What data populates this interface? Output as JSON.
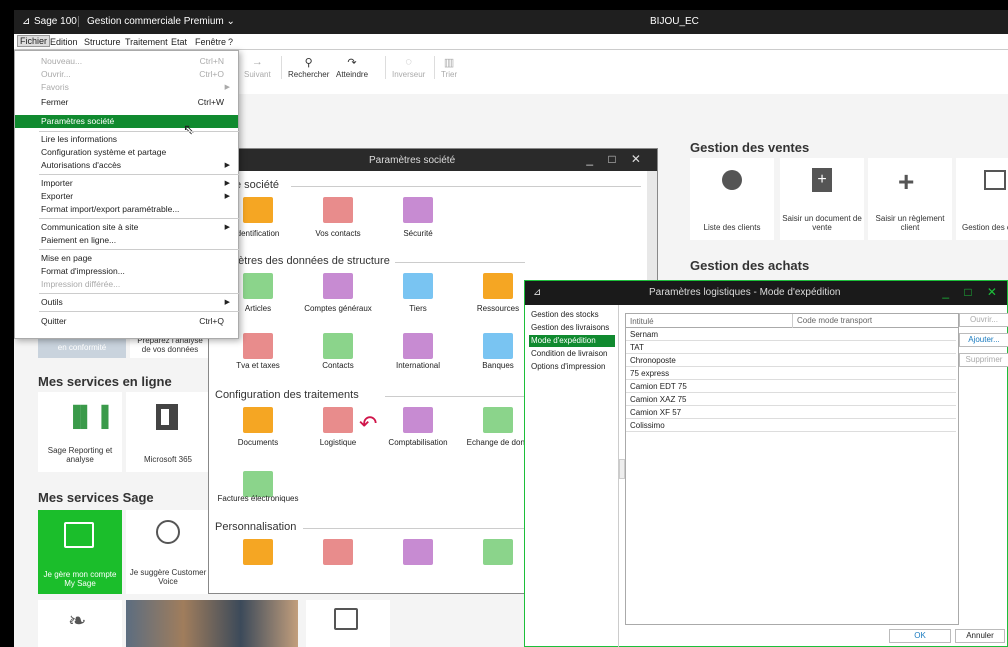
{
  "titlebar": {
    "logo": "⊿",
    "app": "Sage 100",
    "product": "Gestion commerciale Premium ⌄",
    "company": "BIJOU_EC"
  },
  "menubar": [
    "Fichier",
    "Edition",
    "Structure",
    "Traitement",
    "Etat",
    "Fenêtre",
    "?"
  ],
  "toolbar": [
    {
      "label": "nt",
      "icon": ""
    },
    {
      "label": "Suivant",
      "icon": "→",
      "dim": true
    },
    {
      "label": "Rechercher",
      "icon": "🔍"
    },
    {
      "label": "Atteindre",
      "icon": "↷"
    },
    {
      "label": "Inverseur",
      "icon": "◌",
      "dim": true
    },
    {
      "label": "Trier",
      "icon": "▥",
      "dim": true
    }
  ],
  "dropdown": [
    {
      "label": "Nouveau...",
      "shortcut": "Ctrl+N",
      "disabled": true
    },
    {
      "label": "Ouvrir...",
      "shortcut": "Ctrl+O",
      "disabled": true
    },
    {
      "label": "Favoris",
      "arrow": true,
      "disabled": true
    },
    {
      "label": "Fermer",
      "shortcut": "Ctrl+W"
    },
    {
      "label": "Paramètres société",
      "selected": true
    },
    {
      "label": "Lire les informations"
    },
    {
      "label": "Configuration système et partage"
    },
    {
      "label": "Autorisations d'accès",
      "arrow": true
    },
    {
      "label": "Importer",
      "arrow": true
    },
    {
      "label": "Exporter",
      "arrow": true
    },
    {
      "label": "Format import/export paramétrable..."
    },
    {
      "label": "Communication site à site",
      "arrow": true
    },
    {
      "label": "Paiement en ligne..."
    },
    {
      "label": "Mise en page"
    },
    {
      "label": "Format d'impression..."
    },
    {
      "label": "Impression différée...",
      "disabled": true
    },
    {
      "label": "Outils",
      "arrow": true
    },
    {
      "label": "Quitter",
      "shortcut": "Ctrl+Q"
    }
  ],
  "left": {
    "partial_cards": [
      "en conformité",
      "Préparez l'analyse de vos données"
    ],
    "services_online": "Mes services en ligne",
    "reporting": "Sage Reporting et analyse",
    "m365": "Microsoft 365",
    "services_sage": "Mes services Sage",
    "mysage": "Je gère mon compte My Sage",
    "voice": "Je suggère Customer Voice"
  },
  "ventes": {
    "title": "Gestion des ventes",
    "cards": [
      "Liste des clients",
      "Saisir un document de vente",
      "Saisir un règlement client",
      "Gestion des comptes cl"
    ]
  },
  "achats": {
    "title": "Gestion des achats"
  },
  "params": {
    "title": "Paramètres société",
    "sec1": "e société",
    "sec1_items": [
      "dentification",
      "Vos contacts",
      "Sécurité"
    ],
    "sec2": "mètres des données de structure",
    "sec2_items": [
      "Articles",
      "Comptes généraux",
      "Tiers",
      "Ressources",
      "Tva et taxes",
      "Contacts",
      "International",
      "Banques"
    ],
    "sec3": "Configuration des traitements",
    "sec3_items": [
      "Documents",
      "Logistique",
      "Comptabilisation",
      "Echange de donn",
      "Factures électroniques"
    ],
    "sec4": "Personnalisation"
  },
  "logi": {
    "title": "Paramètres logistiques - Mode d'expédition",
    "nav": [
      "Gestion des stocks",
      "Gestion des livraisons",
      "Mode d'expédition",
      "Condition de livraison",
      "Options d'impression"
    ],
    "columns": [
      "Intitulé",
      "Code mode transport"
    ],
    "rows": [
      "Sernam",
      "TAT",
      "Chronoposte",
      "75 express",
      "Camion EDT 75",
      "Camion XAZ 75",
      "Camion XF 57",
      "Colissimo"
    ],
    "buttons": {
      "open": "Ouvrir...",
      "add": "Ajouter...",
      "delete": "Supprimer",
      "ok": "OK",
      "cancel": "Annuler"
    }
  }
}
